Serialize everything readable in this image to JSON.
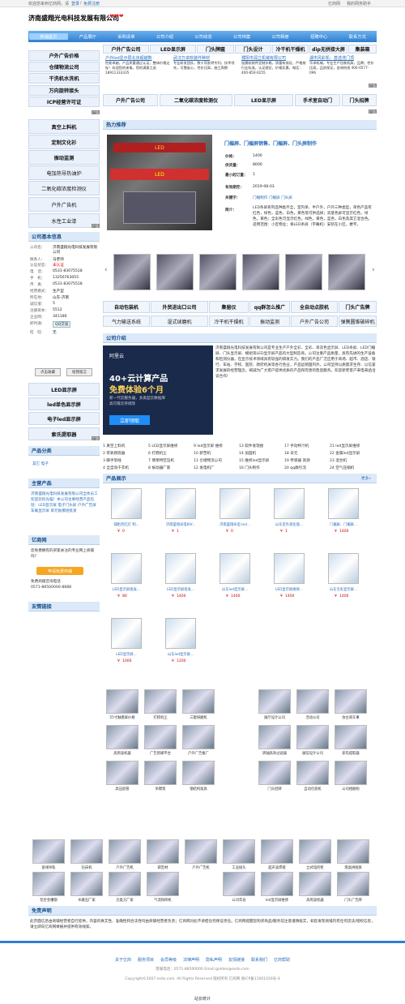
{
  "topbar": {
    "left": "欢迎您来到亿商网，请",
    "login": "登录",
    "sep": "/",
    "register": "免费注册",
    "right1": "亿商网",
    "right2": "我的网务助手"
  },
  "header": {
    "company": "济南盛翔光电科技发展有限公司",
    "hearts": "❤❤❤"
  },
  "nav": [
    "商铺首页",
    "产品展厅",
    "采购清单",
    "公司介绍",
    "公司动态",
    "公司档案",
    "公司相册",
    "招聘中心",
    "联系方式"
  ],
  "left_buttons": [
    "户外广告价格",
    "仓储物流公司",
    "干洗机水洗机",
    "万向旋转接头",
    "ICP经营许可证"
  ],
  "row1": [
    "户外广告公司",
    "LED显示屏",
    "门头牌匾",
    "门头设计",
    "冷干机干燥机",
    "dip无拼接大屏",
    "集装箱"
  ],
  "ads": [
    {
      "title": "户外led显示屏北京超越数",
      "body": "性能卓越，产品质量通过认证，整体价格达标！欢迎您的来电，您的满意之选 18911333335"
    },
    {
      "title": "武汉万卓软装件种材",
      "body": "专业研发团队，数十项发明专利，技术领先，可靠省心，性价比高，施工周期"
    },
    {
      "title": "濮阳市润立机械有限公司",
      "body": "鼠晨软装件定制价格，质量有保证，严格按行业标准，认证就近，价格实惠，电话：400-850-0255"
    },
    {
      "title": "湖市风彩机：甚选洗门顶",
      "body": "华泽机械，专业生产包装机具，品牌；性价比高，品质保证，咨询热线 400-0577-096"
    }
  ],
  "ad_label": "广告",
  "row2": [
    "户外广告公司",
    "二氧化碳浓度检测仪",
    "LED显示屏",
    "手术室自动门",
    "门头招牌"
  ],
  "left_buttons2": [
    "真空上料机",
    "定制文化衫",
    "振动监测",
    "电加热导热油炉",
    "二氧化碳浓度检测仪",
    "户外广告机",
    "水性工业漆"
  ],
  "hot": {
    "heading": "热力推荐",
    "title": "门楣屏、门楣屏销售、门楣屏、门头屏制作",
    "price_label": "价格：",
    "price": "1400",
    "supply_label": "供货量：",
    "supply": "8000",
    "min_label": "最小起订量：",
    "min": "1",
    "valid_label": "有效期至：",
    "valid": "2019-08-03",
    "kw_label": "关键字：",
    "kw": "门楣制作 门楣屏 门头屏",
    "intro_label": "简介：",
    "intro": "LED条屏系列品种类齐全，室内单、半户外，户外三种类型，单色产品有红色，绿色，蓝色，白色，黄色等可供选择；双基色屏可显示红色，绿色，黄色；全彩色可显示红色，绿色，黄色，蓝色，白色及其它混合色。适用范围：小区物业；将LED条屏（字幕机）安装在小区，楼宇。",
    "sign": "LED"
  },
  "nav_arrows": {
    "prev": "‹",
    "next": "›"
  },
  "tags1": [
    "自动包装机",
    "外贸进出口公司",
    "集留仪",
    "qq群怎么推广",
    "全自动点胶机",
    "门头广告牌"
  ],
  "tags2": [
    "气力输送系统",
    "湿式球磨机",
    "冷干机干燥机",
    "振动监测",
    "户外广告公司",
    "弹簧圆锥破碎机"
  ],
  "company_info": {
    "heading": "公司基本信息",
    "rows": [
      [
        "公司名：",
        "济南盛翔光电科技发展有限公司"
      ],
      [
        "联系人：",
        "马老师"
      ],
      [
        "认证状态：",
        "未认证"
      ],
      [
        "电　话：",
        "0531-83075518"
      ],
      [
        "手　机：",
        "13256763055"
      ],
      [
        "传　真：",
        "0531-83075518"
      ],
      [
        "经营模式：",
        "生产型"
      ],
      [
        "所在地：",
        "山东-济南"
      ],
      [
        "诚信值：",
        "5"
      ],
      [
        "注册资本：",
        "5512"
      ],
      [
        "企业网：",
        "341180"
      ],
      [
        "即时通：",
        "QQ交谈"
      ],
      [
        "旺　旺：",
        "无"
      ]
    ],
    "btn1": "点击收藏",
    "btn2": "给我留言"
  },
  "left_buttons3": [
    "LED显示屏",
    "led单色显示屏",
    "电子led显示屏",
    "索氏提取器"
  ],
  "intro": {
    "heading": "公司介绍",
    "text": "济南盛翔光电科技发展有限公司是专业生产户外全彩、全彩、单双色显示屏、LED条屏、LED门楣屏、门头显示屏、模组等LED显示屏产品的大型制造商，公司注重产品质量，具有先进的生产设备和检测仪器，在显示技术领域具有较强的研发实力。我们的产品广泛应用于商场、超市、酒店、银行、车站、学校、医院、政府机关等各行各业，产品远销国内外。公司坚持以质量求生存、以信誉求发展的经营理念，竭诚为广大客户提供优质的产品和完善的售后服务。欢迎新老客户来电来函洽谈合作！"
  },
  "cloud_ad": {
    "brand": "阿里云",
    "line1": "40+云计算产品",
    "line2": "免费体验6个月",
    "line3": "新一代云服务器，多类型云数据库",
    "line4": "高可靠云存储等",
    "btn": "立即领取"
  },
  "product_cat": {
    "heading": "产品分类",
    "item": "其它 电子"
  },
  "numbered": [
    [
      "1 真空上料机",
      "5 LED显示屏维修",
      "9 led显示屏 维修",
      "13 软件发现搜",
      "17 手动榨汁机",
      "21 led显示屏维修"
    ],
    [
      "2 有氧燃烧器",
      "6 打糕机尘",
      "10 新苦机",
      "14 加固机",
      "18 日元",
      "22 金属led显示屏"
    ],
    [
      "3 脚手架线",
      "7 博莱特空压机",
      "11 仓储物流公司",
      "15 维修led显示屏",
      "19 传感器 资源",
      "23 混合机"
    ],
    [
      "4 全自动干衣机",
      "8 振动器厂家",
      "12 发电机厂",
      "16 门头制作",
      "20 qq群引流",
      "24 空气压缩机"
    ]
  ],
  "main_products": {
    "heading": "主营产品",
    "text": "济南盛翔光电科技发展有限公司全体员工欢迎您的光临！本公司主要经营产品包括：LED显示屏 电子门头屏 户外广告屏 车载显示屏 单元板模组批发"
  },
  "yishang": {
    "heading": "亿商网",
    "text": "您免费拥有的买家关注的专业网上商铺吗?",
    "btn": "申请免费商铺",
    "line2": "免费商铺咨询电话",
    "phone": "0571-88500000-8888"
  },
  "friends": {
    "heading": "友情链接"
  },
  "showcase": {
    "heading": "产品展示",
    "more": "更多»",
    "items": [
      {
        "name": "铺柜西红灯 制...",
        "price": "0"
      },
      {
        "name": "济南盛翔光电KIV...",
        "price": "1"
      },
      {
        "name": "济南盛翔光电 led...",
        "price": "0"
      },
      {
        "name": "山东室外高化墙...",
        "price": "1"
      },
      {
        "name": "门楣屏、门楣屏...",
        "price": "1400"
      },
      {
        "name": "LED显示屏批发...",
        "price": "80"
      },
      {
        "name": "LED显示屏批发...",
        "price": "1400"
      },
      {
        "name": "山东led显示屏...",
        "price": "1400"
      },
      {
        "name": "LED显示屏维修...",
        "price": "1400"
      },
      {
        "name": "山东全彩显示屏...",
        "price": "1400"
      },
      {
        "name": "LED显示屏...",
        "price": "1000"
      },
      {
        "name": "山东led显示屏...",
        "price": "1200"
      }
    ]
  },
  "price_symbol": "¥",
  "gallery1": [
    "55寸触摸屏价格",
    "打糕机尘",
    "三辊研磨机",
    "",
    "展厅设计公司",
    "活动公司",
    "仿古商车事"
  ],
  "gallery2": [
    "高周波机器",
    "广告新媒平台",
    "户外广告推广",
    "",
    "转轴高效过滤器",
    "展馆设计公司",
    "索氏提取器"
  ],
  "gallery3": [
    "高压胶管",
    "吊臂架",
    "钢结构家具",
    "",
    "门头招牌",
    "自动包装机",
    "公司相册购"
  ],
  "gallery4": [
    "直线导轨",
    "钻床机",
    "户外广告机",
    "碳型材",
    "户外广告机",
    "工业插头",
    "超声波焊接",
    "立式电控柜",
    "液晶拼接屏"
  ],
  "gallery5": [
    "铝合金槽钢",
    "水磨石厂家",
    "豆类方厂家",
    "气流粉碎机",
    "",
    "公司年会",
    "led显示屏维修",
    "高周波机器",
    "门头广告牌"
  ],
  "disclaimer": {
    "heading": "免责声明",
    "text": "此页面信息由商铺经营者自行提供，内容的真实性、准确性和合法性均由商铺经营者负责；亿商网对此不承担任何保证责任。亿商网提醒您购买商品/服务前注意谨慎核实，如您发现商铺内有任何违法/侵权信息，请立即向亿商网举报并提供有效线索。"
  },
  "footer": {
    "links": [
      "关于亿商",
      "服务项目",
      "会员等级",
      "法律声明",
      "隐私声明",
      "友情链接",
      "联系我们",
      "亿商帮助"
    ],
    "hotline": "客服电话：0571-88500000 Email:golden@esdo.com",
    "copyright": "Copyright©2007 esdo.com. All Rights Reserved 版权所有 亿商网 浙ICP备11001026号-4",
    "bottom": "站长统计"
  },
  "colors": {
    "nav": "#2f7fd0",
    "accent": "#d00",
    "section": "#dbe9f8"
  }
}
